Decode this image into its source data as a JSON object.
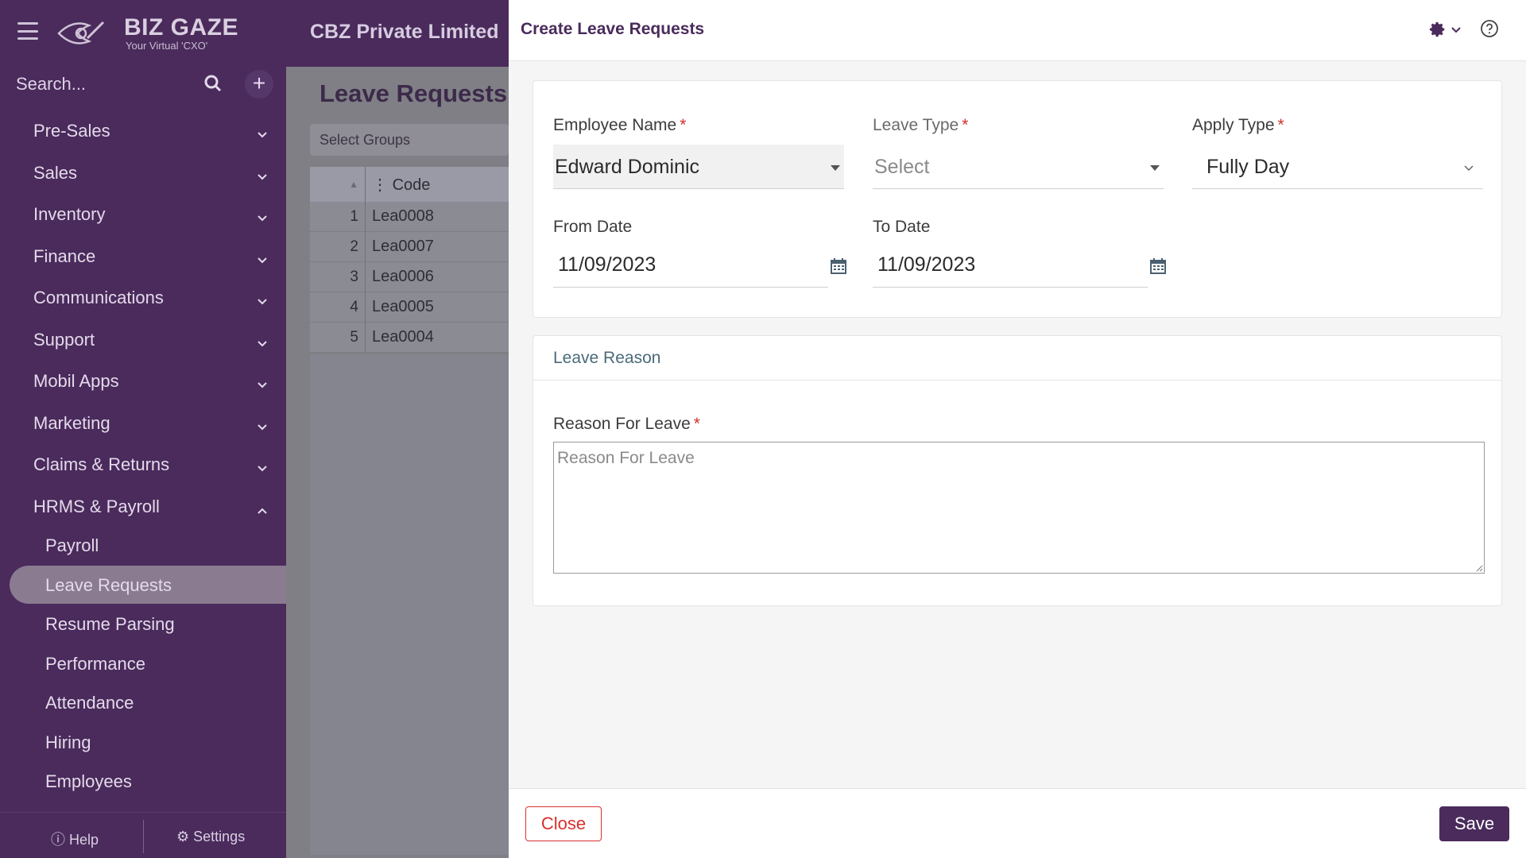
{
  "app": {
    "logo_text": "BIZ GAZE",
    "logo_tagline": "Your Virtual 'CXO'",
    "company": "CBZ Private Limited"
  },
  "sidebar": {
    "search_placeholder": "Search...",
    "menu": [
      {
        "label": "Pre-Sales"
      },
      {
        "label": "Sales"
      },
      {
        "label": "Inventory"
      },
      {
        "label": "Finance"
      },
      {
        "label": "Communications"
      },
      {
        "label": "Support"
      },
      {
        "label": "Mobil Apps"
      },
      {
        "label": "Marketing"
      },
      {
        "label": "Claims & Returns"
      },
      {
        "label": "HRMS & Payroll"
      }
    ],
    "submenu": [
      {
        "label": "Payroll"
      },
      {
        "label": "Leave Requests"
      },
      {
        "label": "Resume Parsing"
      },
      {
        "label": "Performance"
      },
      {
        "label": "Attendance"
      },
      {
        "label": "Hiring"
      },
      {
        "label": "Employees"
      }
    ],
    "help_label": "Help",
    "settings_label": "Settings"
  },
  "background_page": {
    "title": "Leave Requests",
    "groups_label": "Select Groups",
    "code_header": "Code",
    "rows": [
      {
        "num": "1",
        "code": "Lea0008"
      },
      {
        "num": "2",
        "code": "Lea0007"
      },
      {
        "num": "3",
        "code": "Lea0006"
      },
      {
        "num": "4",
        "code": "Lea0005"
      },
      {
        "num": "5",
        "code": "Lea0004"
      }
    ]
  },
  "modal": {
    "title": "Create Leave Requests",
    "employee_name": {
      "label": "Employee Name",
      "value": "Edward Dominic"
    },
    "leave_type": {
      "label": "Leave Type",
      "placeholder": "Select"
    },
    "apply_type": {
      "label": "Apply Type",
      "value": "Fully Day"
    },
    "from_date": {
      "label": "From Date",
      "value": "11/09/2023"
    },
    "to_date": {
      "label": "To Date",
      "value": "11/09/2023"
    },
    "reason_section": "Leave Reason",
    "reason": {
      "label": "Reason For Leave",
      "placeholder": "Reason For Leave"
    },
    "close_label": "Close",
    "save_label": "Save"
  },
  "colors": {
    "brand": "#4a2b5c",
    "danger": "#d9302c"
  }
}
